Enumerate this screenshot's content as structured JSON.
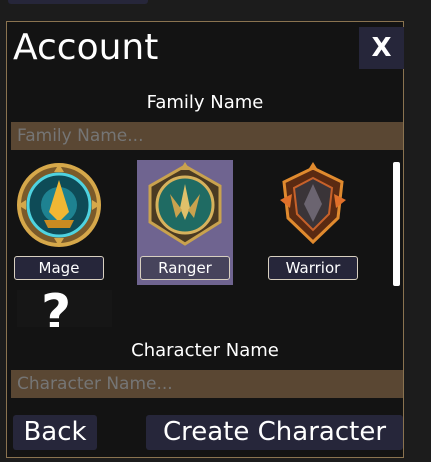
{
  "account": {
    "title": "Account",
    "close_label": "X",
    "family_name_label": "Family Name",
    "family_name_placeholder": "Family Name...",
    "family_name_value": "",
    "character_name_label": "Character Name",
    "character_name_placeholder": "Character Name...",
    "character_name_value": "",
    "classes": [
      {
        "label": "Mage",
        "icon": "mage-emblem-icon",
        "selected": false
      },
      {
        "label": "Ranger",
        "icon": "ranger-emblem-icon",
        "selected": true
      },
      {
        "label": "Warrior",
        "icon": "warrior-emblem-icon",
        "selected": false
      }
    ],
    "partial_glyph": "?",
    "back_label": "Back",
    "create_label": "Create Character"
  },
  "colors": {
    "panel_border": "#8a7350",
    "input_background": "#5a4733",
    "button_background": "#26263a",
    "selected_card": "#6f6490"
  }
}
